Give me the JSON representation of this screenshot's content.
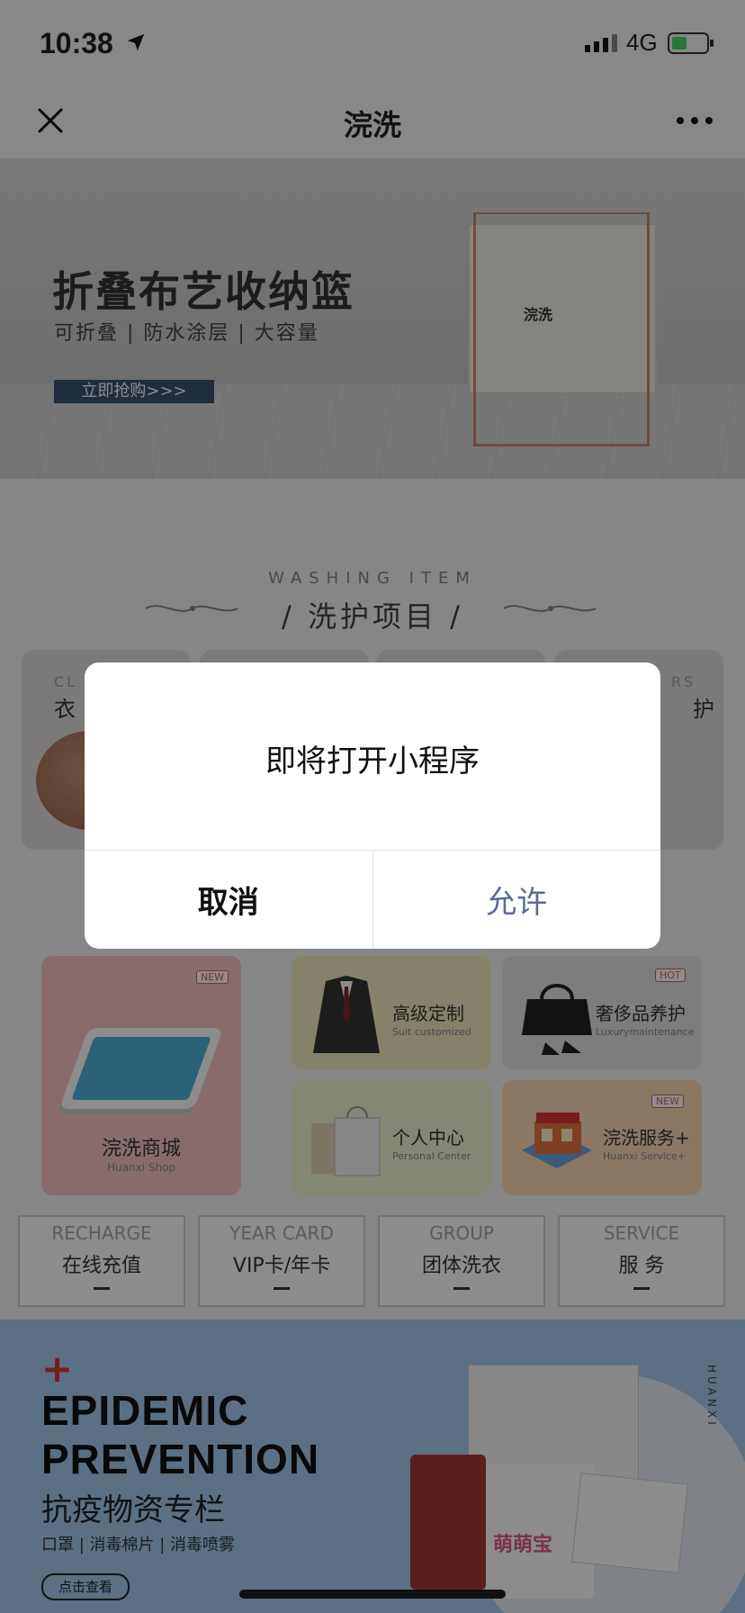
{
  "status_bar": {
    "time": "10:38",
    "network": "4G"
  },
  "nav": {
    "title": "浣洗"
  },
  "banner": {
    "headline": "折叠布艺收纳篮",
    "subline": "可折叠 | 防水涂层 | 大容量",
    "cta": "立即抢购>>>",
    "logo": "浣洗"
  },
  "section": {
    "en": "WASHING ITEM",
    "cn": "/ 洗护项目 /"
  },
  "categories": [
    {
      "en": "CL",
      "cn": "衣"
    },
    {
      "en": "",
      "cn": ""
    },
    {
      "en": "",
      "cn": ""
    },
    {
      "en": "RS",
      "cn": "护"
    }
  ],
  "dialog": {
    "message": "即将打开小程序",
    "cancel": "取消",
    "allow": "允许"
  },
  "tiles": {
    "shop": {
      "title": "浣洗商城",
      "sub": "Huanxi Shop",
      "badge": "NEW"
    },
    "suit": {
      "title": "高级定制",
      "sub": "Suit customized"
    },
    "lux": {
      "title": "奢侈品养护",
      "sub": "Luxurymaintenance",
      "badge": "HOT"
    },
    "center": {
      "title": "个人中心",
      "sub": "Personal Center"
    },
    "service": {
      "title": "浣洗服务+",
      "sub": "Huanxi Service+",
      "badge": "NEW"
    }
  },
  "quick": [
    {
      "en": "RECHARGE",
      "cn": "在线充值"
    },
    {
      "en": "YEAR CARD",
      "cn": "VIP卡/年卡"
    },
    {
      "en": "GROUP",
      "cn": "团体洗衣"
    },
    {
      "en": "SERVICE",
      "cn": "服 务"
    }
  ],
  "epidemic": {
    "plus": "+",
    "line1": "EPIDEMIC",
    "line2": "PREVENTION",
    "cn": "抗疫物资专栏",
    "sub": "口罩 | 消毒棉片 | 消毒喷雾",
    "button": "点击查看",
    "vertical": "HUANXI",
    "product_label": "萌萌宝"
  }
}
